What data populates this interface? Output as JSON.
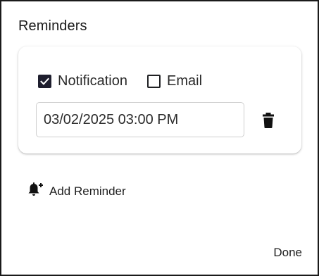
{
  "dialog": {
    "title": "Reminders",
    "done_label": "Done"
  },
  "reminder": {
    "notification_label": "Notification",
    "notification_checked": true,
    "email_label": "Email",
    "email_checked": false,
    "datetime_value": "03/02/2025 03:00 PM",
    "delete_icon": "trash-icon"
  },
  "actions": {
    "add_reminder_label": "Add Reminder",
    "add_reminder_icon": "bell-plus-icon"
  },
  "colors": {
    "checkbox_checked": "#1e1e2e",
    "text": "#1f1f1f",
    "field_border": "#cfcfcf"
  }
}
